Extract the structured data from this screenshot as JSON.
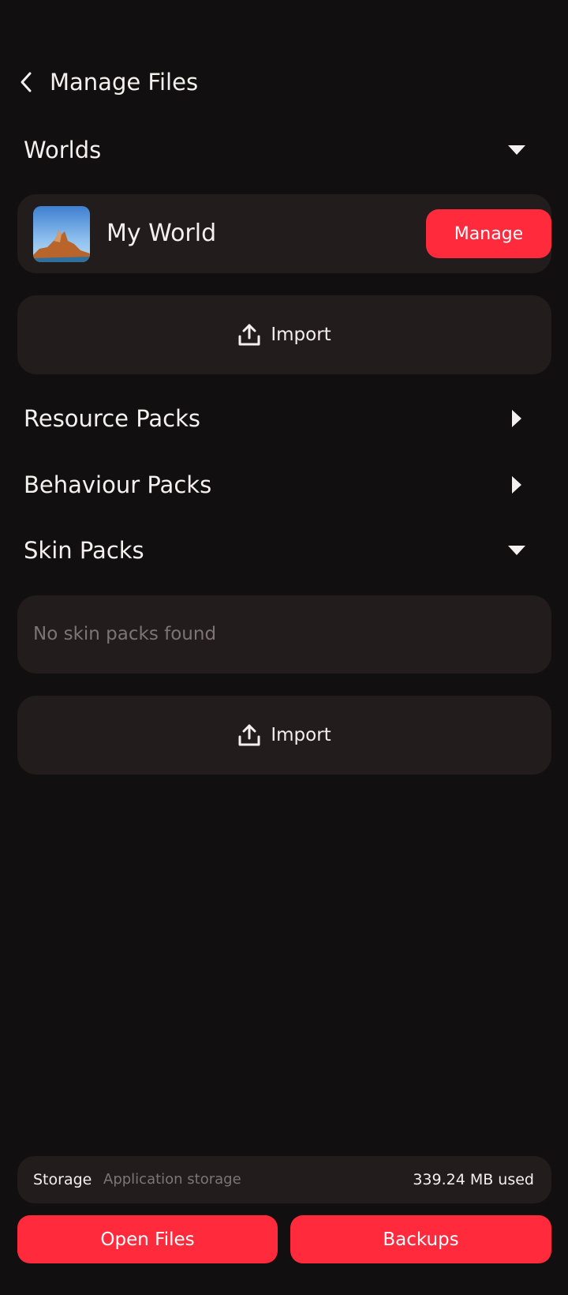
{
  "header": {
    "title": "Manage Files",
    "back_icon": "chevron-left-icon"
  },
  "sections": {
    "worlds": {
      "title": "Worlds",
      "expanded": true,
      "items": [
        {
          "name": "My World",
          "action_label": "Manage"
        }
      ],
      "import_label": "Import"
    },
    "resource_packs": {
      "title": "Resource Packs",
      "expanded": false
    },
    "behaviour_packs": {
      "title": "Behaviour Packs",
      "expanded": false
    },
    "skin_packs": {
      "title": "Skin Packs",
      "expanded": true,
      "empty_text": "No skin packs found",
      "import_label": "Import"
    }
  },
  "storage": {
    "label": "Storage",
    "location": "Application storage",
    "used": "339.24 MB used"
  },
  "buttons": {
    "open_files": "Open Files",
    "backups": "Backups"
  },
  "colors": {
    "background": "#120f10",
    "card": "#221c1c",
    "accent": "#ff2a3c",
    "text": "#f4f0f0",
    "muted_text": "#7d7575"
  }
}
